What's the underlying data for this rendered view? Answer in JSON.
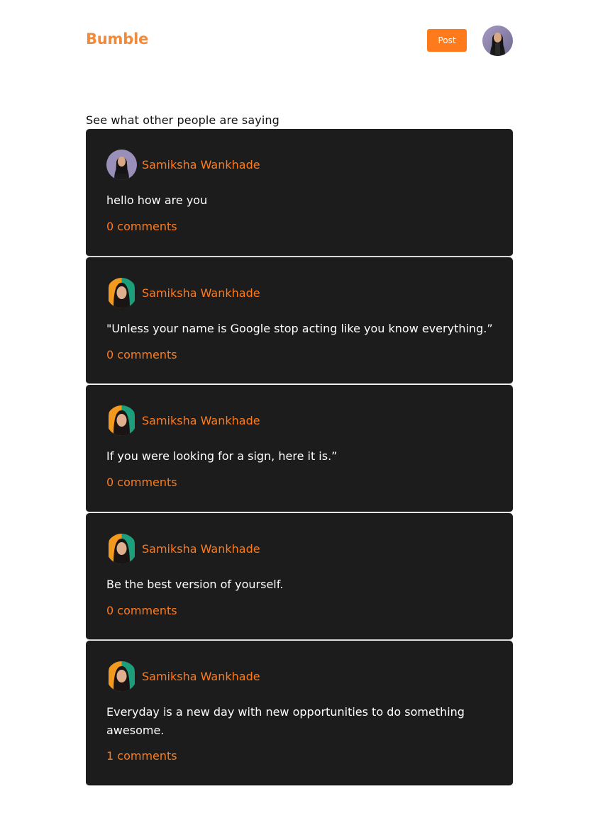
{
  "colors": {
    "accent": "#ff7a1a",
    "brand": "#f28a3c",
    "card_bg": "#1c1c1c",
    "card_text": "#ffffff"
  },
  "header": {
    "brand": "Bumble",
    "post_button": "Post",
    "avatar_icon": "user-avatar-icon"
  },
  "feed": {
    "heading": "See what other people are saying",
    "posts": [
      {
        "author": "Samiksha Wankhade",
        "text": "hello how are you",
        "comments": "0 comments"
      },
      {
        "author": "Samiksha Wankhade",
        "text": "\"Unless your name is Google stop acting like you know everything.”",
        "comments": "0 comments"
      },
      {
        "author": "Samiksha Wankhade",
        "text": "If you were looking for a sign, here it is.”",
        "comments": "0 comments"
      },
      {
        "author": "Samiksha Wankhade",
        "text": "Be the best version of yourself.",
        "comments": "0 comments"
      },
      {
        "author": "Samiksha Wankhade",
        "text": "Everyday is a new day with new opportunities to do something awesome.",
        "comments": "1 comments"
      }
    ]
  }
}
